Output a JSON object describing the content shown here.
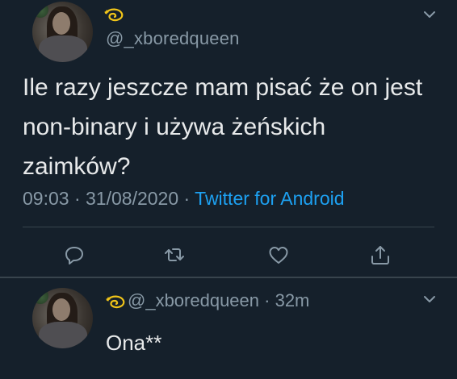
{
  "main_tweet": {
    "handle": "@_xboredqueen",
    "text": "Ile razy jeszcze mam pisać że on jest non-binary i używa żeńskich zaimków?",
    "time": "09:03",
    "date": "31/08/2020",
    "separator": " · ",
    "source": "Twitter for Android",
    "name_icon": "dizzy-sparkle-emoji"
  },
  "reply_tweet": {
    "handle": "@_xboredqueen",
    "time": "32m",
    "separator": " · ",
    "text": "Ona**",
    "name_icon": "dizzy-sparkle-emoji"
  },
  "actions": [
    "reply-icon",
    "retweet-icon",
    "like-icon",
    "share-icon"
  ],
  "colors": {
    "background": "#15202b",
    "text": "#e7e9ea",
    "secondary": "#8899a6",
    "link": "#1da1f2",
    "divider": "#38444d"
  }
}
